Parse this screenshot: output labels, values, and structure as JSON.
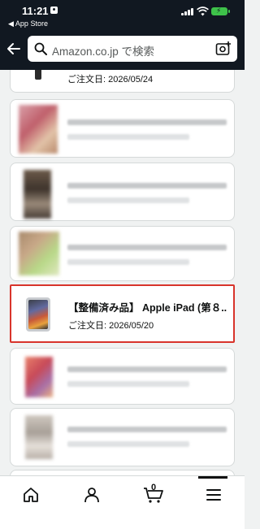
{
  "status_bar": {
    "time": "11:21",
    "back_label": "◀ App Store",
    "battery_icon": "battery-charging-icon"
  },
  "search": {
    "placeholder": "Amazon.co.jp で検索"
  },
  "orders": [
    {
      "kind": "partial",
      "date": "ご注文日: 2026/05/24"
    },
    {
      "kind": "blurred"
    },
    {
      "kind": "blurred"
    },
    {
      "kind": "blurred"
    },
    {
      "kind": "highlighted",
      "title": "【整備済み品】 Apple iPad (第８...",
      "date": "ご注文日: 2026/05/20"
    },
    {
      "kind": "blurred"
    },
    {
      "kind": "blurred"
    }
  ],
  "tabbar": {
    "cart_count": "0",
    "items": [
      "home-icon",
      "account-icon",
      "cart-icon",
      "menu-icon"
    ]
  },
  "colors": {
    "header_bg": "#111821",
    "highlight_border": "#d8342b",
    "battery": "#3ec24a"
  }
}
